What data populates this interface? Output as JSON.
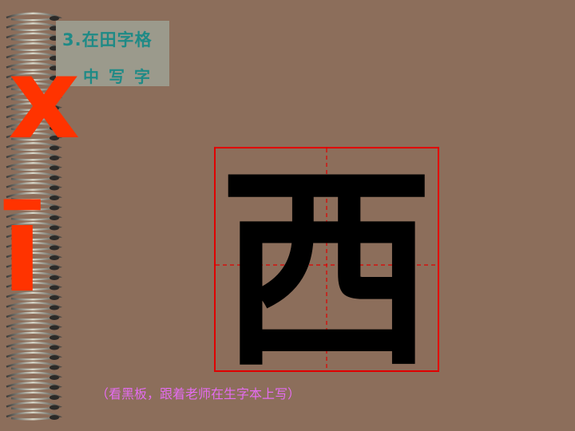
{
  "title": {
    "line1": "3.在田字格",
    "line2": "中写字"
  },
  "pinyin": {
    "initial": "x",
    "final": "ī"
  },
  "practice_char": "西",
  "note": "（看黑板，跟着老师在生字本上写）",
  "colors": {
    "background": "#8c6e5b",
    "grid_line": "#e00000",
    "title_text": "#1f8a86",
    "pinyin": "#ff3300",
    "note_text": "#e46cf0"
  }
}
